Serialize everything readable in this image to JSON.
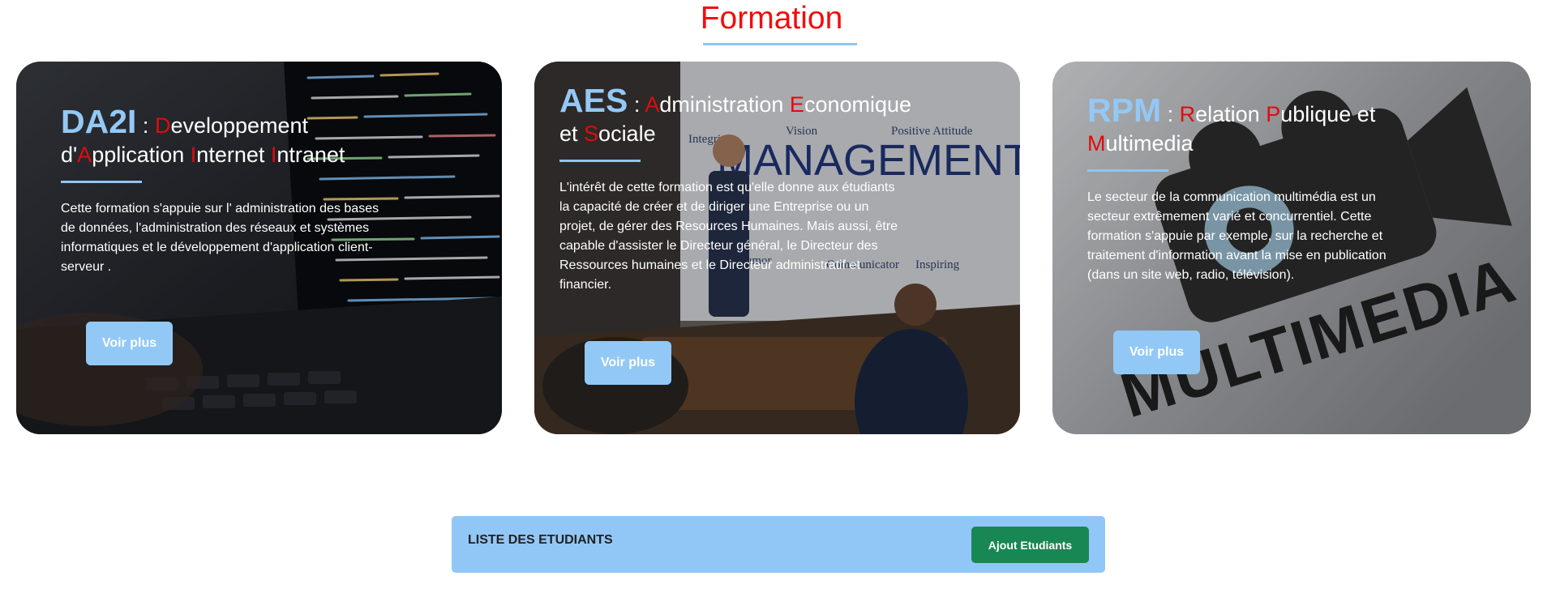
{
  "section": {
    "title": "Formation"
  },
  "cards": [
    {
      "abbr": "DA2I",
      "sep": " : ",
      "name_parts": [
        {
          "t": "D",
          "r": true
        },
        {
          "t": "eveloppement d'",
          "r": false
        },
        {
          "t": "A",
          "r": true
        },
        {
          "t": "pplication ",
          "r": false
        },
        {
          "t": "I",
          "r": true
        },
        {
          "t": "nternet ",
          "r": false
        },
        {
          "t": "I",
          "r": true
        },
        {
          "t": "ntranet",
          "r": false
        }
      ],
      "description": "Cette formation s'appuie sur l' administration des bases de données, l'administration des réseaux et systèmes informatiques et le développement d'application client-serveur .",
      "button": "Voir plus"
    },
    {
      "abbr": "AES",
      "sep": " : ",
      "name_parts": [
        {
          "t": "A",
          "r": true
        },
        {
          "t": "dministration ",
          "r": false
        },
        {
          "t": "E",
          "r": true
        },
        {
          "t": "conomique et ",
          "r": false
        },
        {
          "t": "S",
          "r": true
        },
        {
          "t": "ociale",
          "r": false
        }
      ],
      "description": "L'intérêt de cette formation est qu'elle donne aux étudiants la capacité de créer et de diriger une Entreprise ou un projet, de gérer des Resources Humaines. Mais aussi, être capable d'assister le Directeur général, le Directeur des Ressources humaines et le Directeur administratif et financier.",
      "button": "Voir plus",
      "board_word": "MANAGEMENT",
      "board_labels": [
        "Integrity",
        "Vision",
        "Positive Attitude",
        "Communicator",
        "Inspiring",
        "Humor"
      ]
    },
    {
      "abbr": "RPM",
      "sep": " : ",
      "name_parts": [
        {
          "t": "R",
          "r": true
        },
        {
          "t": "elation ",
          "r": false
        },
        {
          "t": "P",
          "r": true
        },
        {
          "t": "ublique et ",
          "r": false
        },
        {
          "t": "M",
          "r": true
        },
        {
          "t": "ultimedia",
          "r": false
        }
      ],
      "description": "Le secteur de la communication multimédia est un secteur extrêmement varié et concurrentiel. Cette formation s'appuie par exemple, sur la recherche et traitement d'information avant la mise en publication (dans un site web, radio, télévision).",
      "button": "Voir plus",
      "bg_word": "MULTIMEDIA"
    }
  ],
  "students_bar": {
    "title": "LISTE DES ETUDIANTS",
    "add_button": "Ajout Etudiants"
  }
}
